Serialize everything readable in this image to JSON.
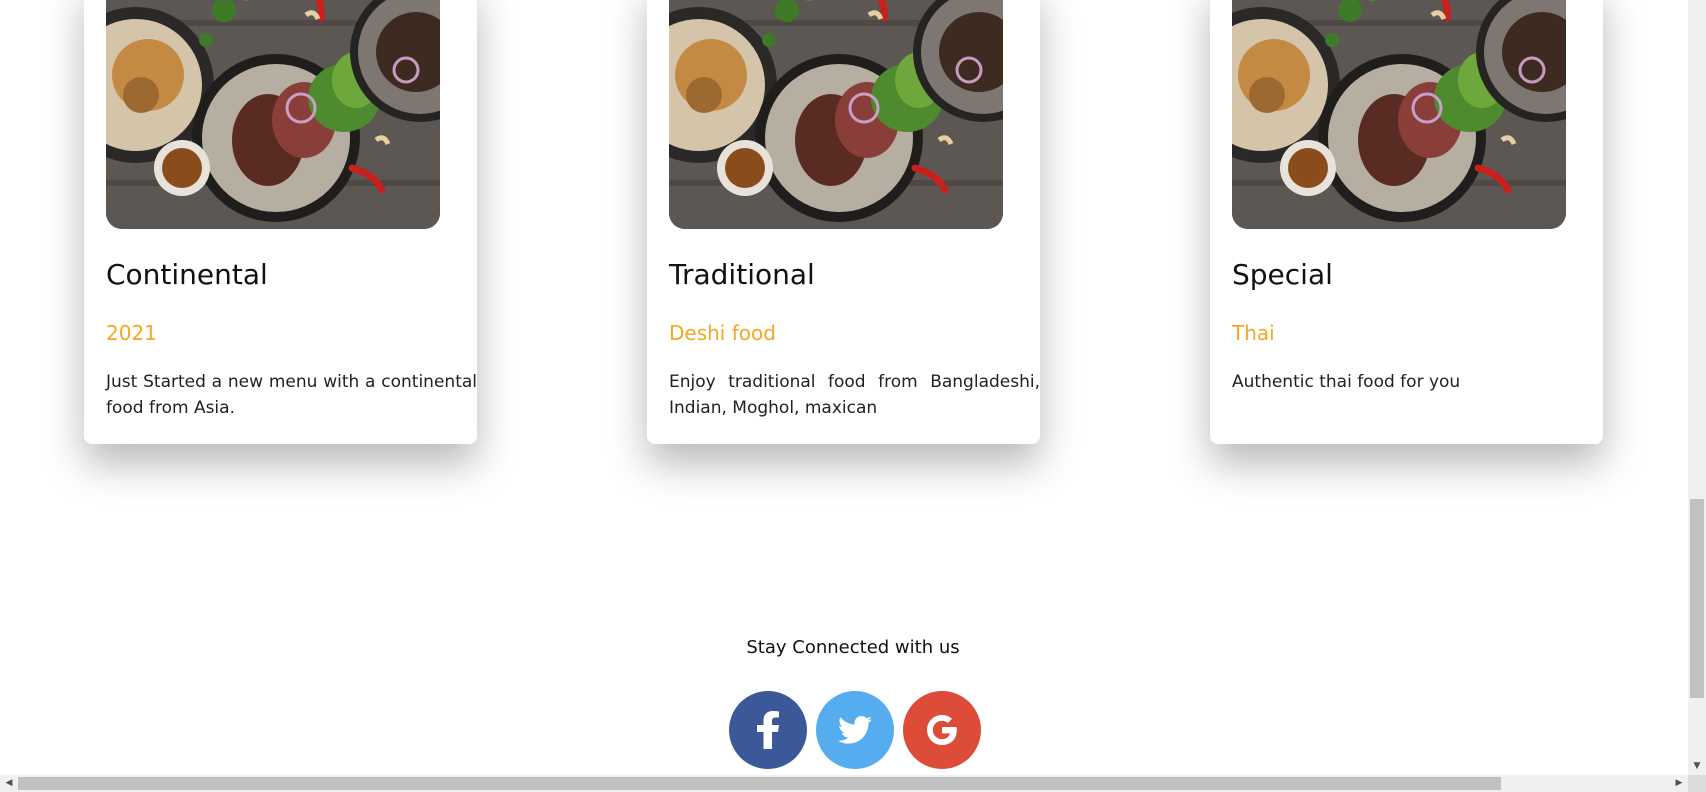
{
  "cards": [
    {
      "title": "Continental",
      "subtitle": "2021",
      "text": "Just Started a new menu with a continental food from Asia."
    },
    {
      "title": "Traditional",
      "subtitle": "Deshi food",
      "text": "Enjoy traditional food from Bangladeshi, Indian, Moghol, maxican"
    },
    {
      "title": "Special",
      "subtitle": "Thai",
      "text": "Authentic thai food for you"
    }
  ],
  "social": {
    "title": "Stay Connected with us",
    "buttons": [
      {
        "icon": "facebook-icon",
        "color": "#3b5998"
      },
      {
        "icon": "twitter-icon",
        "color": "#55acee"
      },
      {
        "icon": "google-icon",
        "color": "#dd4b39"
      }
    ]
  },
  "colors": {
    "accent": "#f5a623",
    "text": "#111111"
  }
}
